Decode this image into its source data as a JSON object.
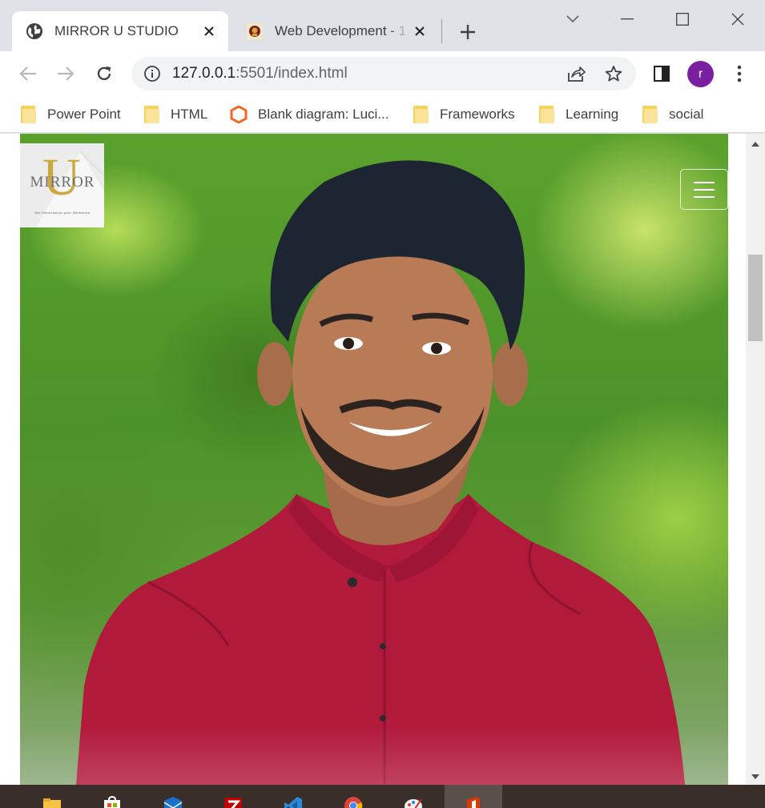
{
  "browser": {
    "tabs": [
      {
        "title": "MIRROR U STUDIO",
        "favicon": "globe-icon",
        "active": true
      },
      {
        "title": "Web Development - 1",
        "favicon": "university-crest-icon",
        "active": false
      }
    ],
    "address_bar": {
      "host": "127.0.0.1",
      "rest": ":5501/index.html"
    },
    "profile_initial": "r",
    "profile_color": "#7b1fa2"
  },
  "bookmarks": [
    {
      "label": "Power Point",
      "icon": "folder-icon"
    },
    {
      "label": "HTML",
      "icon": "folder-icon"
    },
    {
      "label": "Blank diagram: Luci...",
      "icon": "lucidchart-icon"
    },
    {
      "label": "Frameworks",
      "icon": "folder-icon"
    },
    {
      "label": "Learning",
      "icon": "folder-icon"
    },
    {
      "label": "social",
      "icon": "folder-icon"
    }
  ],
  "page": {
    "logo": {
      "letter": "U",
      "word": "MIRROR",
      "tagline": "We Immortalize your Memories"
    },
    "navbar_toggler": "hamburger-menu-icon",
    "hero_image": "portrait-photo"
  },
  "taskbar": [
    {
      "app": "file-explorer-icon"
    },
    {
      "app": "microsoft-store-icon"
    },
    {
      "app": "mail-icon"
    },
    {
      "app": "filezilla-icon"
    },
    {
      "app": "vscode-icon"
    },
    {
      "app": "chrome-icon"
    },
    {
      "app": "paint-icon"
    },
    {
      "app": "office-icon",
      "active": true
    }
  ]
}
